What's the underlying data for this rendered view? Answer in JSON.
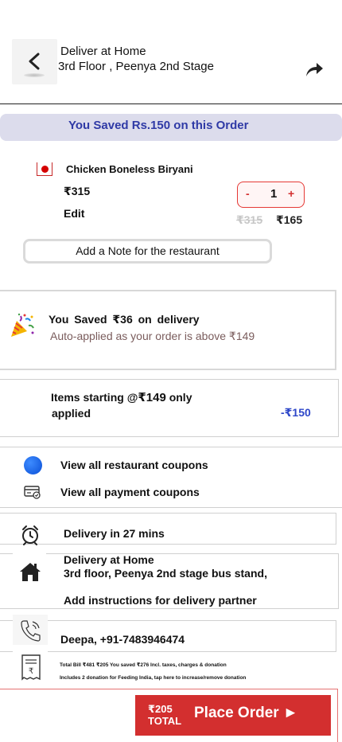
{
  "header": {
    "deliver_label": "Deliver at Home",
    "address_short": "3rd Floor , Peenya 2nd Stage"
  },
  "savings_banner": "You  Saved Rs.150 on this Order",
  "item": {
    "name": "Chicken Boneless Biryani",
    "price": "₹315",
    "edit_label": "Edit",
    "qty_minus": "-",
    "qty_count": "1",
    "qty_plus": "+",
    "old_price": "₹315",
    "new_price": "₹165"
  },
  "note_button": "Add a Note for the restaurant",
  "delivery_savings": {
    "title": "You  Saved  ₹36  on delivery",
    "subtitle": "Auto-applied as your order is above ₹149"
  },
  "offer": {
    "line1_prefix": "Items starting @",
    "line1_amount": "₹149",
    "line1_suffix": " only",
    "line2": "applied",
    "discount": "-₹150"
  },
  "coupons": {
    "restaurant": "View all restaurant coupons",
    "payment": "View all payment coupons"
  },
  "delivery_time": "Delivery in 27 mins",
  "address": {
    "title": "Delivery at Home",
    "detail": "3rd floor, Peenya 2nd stage bus stand,",
    "instructions": "Add instructions for delivery partner"
  },
  "contact": "Deepa, +91-7483946474",
  "bill": {
    "line1": "Total Bill ₹481 ₹205 You saved ₹276 Incl. taxes, charges & donation",
    "line2": "Includes 2 donation for Feeding India, tap here to increase/remove donation"
  },
  "place_order": {
    "total_amount": "₹205",
    "total_label": "TOTAL",
    "button_label": "Place Order ►"
  },
  "colors": {
    "accent_red": "#d32f2f",
    "savings_blue": "#2f3aa6",
    "discount_blue": "#2e47c9"
  }
}
